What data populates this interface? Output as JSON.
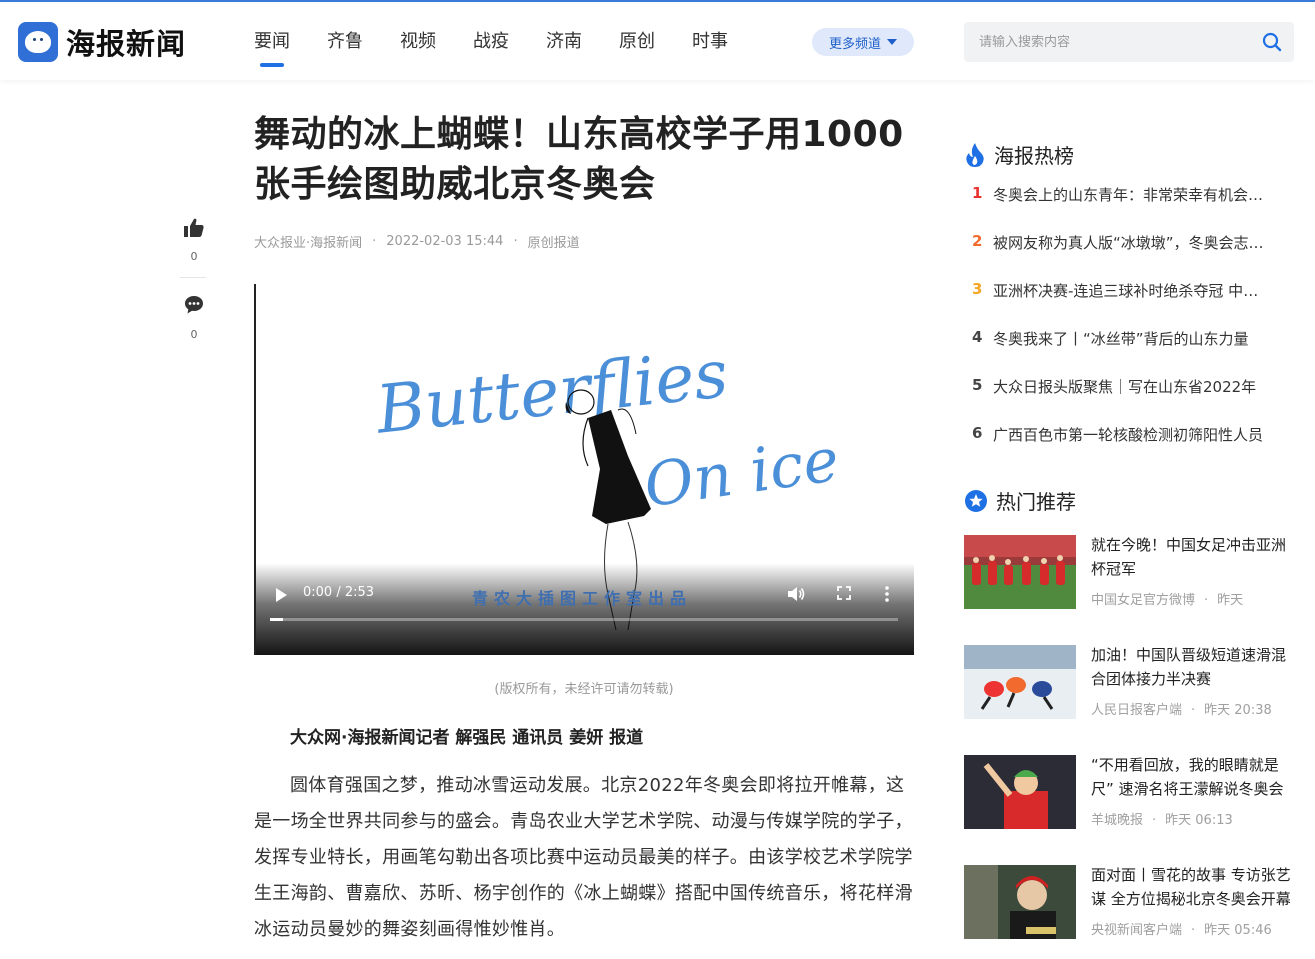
{
  "header": {
    "logo_text": "海报新闻",
    "nav": [
      "要闻",
      "齐鲁",
      "视频",
      "战疫",
      "济南",
      "原创",
      "时事"
    ],
    "more_channels": "更多频道",
    "search_placeholder": "请输入搜索内容"
  },
  "toolbar": {
    "like_count": "0",
    "comment_count": "0"
  },
  "article": {
    "title": "舞动的冰上蝴蝶！山东高校学子用1000张手绘图助威北京冬奥会",
    "source": "大众报业·海报新闻",
    "date": "2022-02-03 15:44",
    "type": "原创报道",
    "video": {
      "art_line1": "Butterflies",
      "art_line2": "On ice",
      "studio_credit": "青农大插图工作室出品",
      "time": "0:00 / 2:53",
      "progress": 0.02
    },
    "caption": "(版权所有，未经许可请勿转载)",
    "byline": "大众网·海报新闻记者 解强民 通讯员 姜妍 报道",
    "paragraph": "圆体育强国之梦，推动冰雪运动发展。北京2022年冬奥会即将拉开帷幕，这是一场全世界共同参与的盛会。青岛农业大学艺术学院、动漫与传媒学院的学子，发挥专业特长，用画笔勾勒出各项比赛中运动员最美的样子。由该学校艺术学院学生王海韵、曹嘉欣、苏昕、杨宇创作的《冰上蝴蝶》搭配中国传统音乐，将花样滑冰运动员曼妙的舞姿刻画得惟妙惟肖。"
  },
  "sidebar": {
    "hot_title": "海报热榜",
    "hot_list": [
      {
        "rank": "1",
        "text": "冬奥会上的山东青年：非常荣幸有机会参与",
        "color": "#e8332f"
      },
      {
        "rank": "2",
        "text": "被网友称为真人版“冰墩墩”，冬奥会志愿者",
        "color": "#f26a2d"
      },
      {
        "rank": "3",
        "text": "亚洲杯决赛-连追三球补时绝杀夺冠 中国女足",
        "color": "#f5a623"
      },
      {
        "rank": "4",
        "text": "冬奥我来了丨“冰丝带”背后的山东力量",
        "color": "#444444"
      },
      {
        "rank": "5",
        "text": "大众日报头版聚焦｜写在山东省2022年",
        "color": "#444444"
      },
      {
        "rank": "6",
        "text": "广西百色市第一轮核酸检测初筛阳性人员",
        "color": "#444444"
      }
    ],
    "rec_title": "热门推荐",
    "recommend": [
      {
        "title": "就在今晚！中国女足冲击亚洲杯冠军",
        "source": "中国女足官方微博",
        "time": "昨天"
      },
      {
        "title": "加油！中国队晋级短道速滑混合团体接力半决赛",
        "source": "人民日报客户端",
        "time": "昨天 20:38"
      },
      {
        "title": "“不用看回放，我的眼睛就是尺” 速滑名将王濛解说冬奥会",
        "source": "羊城晚报",
        "time": "昨天 06:13"
      },
      {
        "title": "面对面丨雪花的故事 专访张艺谋 全方位揭秘北京冬奥会开幕式",
        "source": "央视新闻客户端",
        "time": "昨天 05:46"
      }
    ]
  },
  "colors": {
    "brand_blue": "#1f6fe5",
    "rank1": "#e8332f",
    "rank2": "#f26a2d",
    "rank3": "#f5a623"
  }
}
